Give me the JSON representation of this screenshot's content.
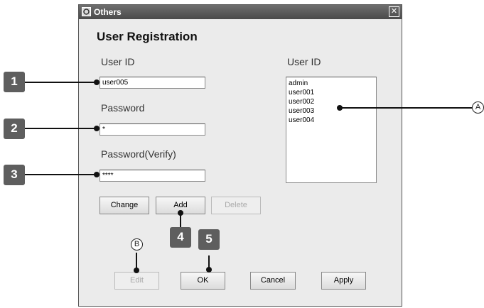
{
  "window": {
    "title": "Others",
    "close_glyph": "✕"
  },
  "form": {
    "heading": "User Registration",
    "user_id_label": "User ID",
    "user_id_value": "user005",
    "password_label": "Password",
    "password_value": "*",
    "password_verify_label": "Password(Verify)",
    "password_verify_value": "****"
  },
  "user_list": {
    "label": "User ID",
    "items": [
      "admin",
      "user001",
      "user002",
      "user003",
      "user004"
    ]
  },
  "buttons": {
    "change": "Change",
    "add": "Add",
    "delete": "Delete",
    "edit": "Edit",
    "ok": "OK",
    "cancel": "Cancel",
    "apply": "Apply"
  },
  "callouts": {
    "one": "1",
    "two": "2",
    "three": "3",
    "four": "4",
    "five": "5",
    "a": "A",
    "b": "B"
  }
}
